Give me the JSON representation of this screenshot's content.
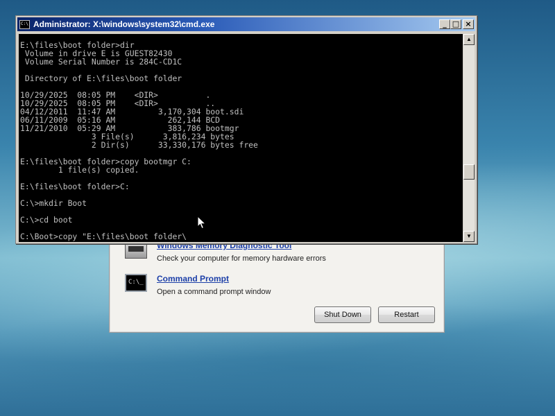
{
  "cmd_window": {
    "title": "Administrator: X:\\windows\\system32\\cmd.exe",
    "console_lines": [
      "E:\\files\\boot folder>dir",
      " Volume in drive E is GUEST82430",
      " Volume Serial Number is 284C-CD1C",
      "",
      " Directory of E:\\files\\boot folder",
      "",
      "10/29/2025  08:05 PM    <DIR>          .",
      "10/29/2025  08:05 PM    <DIR>          ..",
      "04/12/2011  11:47 AM         3,170,304 boot.sdi",
      "06/11/2009  05:16 AM           262,144 BCD",
      "11/21/2010  05:29 AM           383,786 bootmgr",
      "               3 File(s)      3,816,234 bytes",
      "               2 Dir(s)      33,330,176 bytes free",
      "",
      "E:\\files\\boot folder>copy bootmgr C:",
      "        1 file(s) copied.",
      "",
      "E:\\files\\boot folder>C:",
      "",
      "C:\\>mkdir Boot",
      "",
      "C:\\>cd boot",
      "",
      "C:\\Boot>copy \"E:\\files\\boot folder\\"
    ],
    "scrollbar": {
      "position_fraction": 0.7
    }
  },
  "recovery_dialog": {
    "items": [
      {
        "title": "Windows Memory Diagnostic Tool",
        "description": "Check your computer for memory hardware errors",
        "icon": "memory-chip-icon"
      },
      {
        "title": "Command Prompt",
        "description": "Open a command prompt window",
        "icon": "command-prompt-icon"
      }
    ],
    "buttons": {
      "shutdown": "Shut Down",
      "restart": "Restart"
    }
  }
}
